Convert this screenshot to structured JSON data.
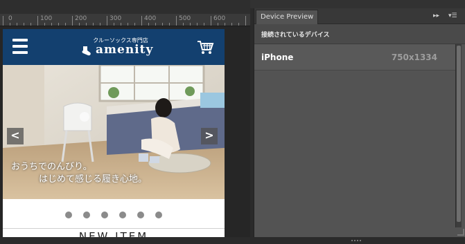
{
  "ruler": {
    "labels": [
      "0",
      "100",
      "200",
      "300",
      "400",
      "500",
      "600"
    ]
  },
  "site": {
    "menu_icon": "hamburger-icon",
    "logo_sub": "クルーソックス専門店",
    "logo_main": "amenity",
    "cart_icon": "shopping-cart-icon",
    "prev_label": "<",
    "next_label": ">",
    "caption_line1": "おうちでのんびり。",
    "caption_line2": "はじめて感じる履き心地。",
    "dots_count": 6,
    "new_item": "NEW ITEM"
  },
  "panel": {
    "tab_title": "Device Preview",
    "expand_label": "▸▸",
    "menu_label": "▾☰",
    "section_label": "接続されているデバイス",
    "devices": [
      {
        "name": "iPhone",
        "resolution": "750x1334"
      }
    ]
  },
  "colors": {
    "header": "#13406f",
    "panel": "#535353"
  }
}
